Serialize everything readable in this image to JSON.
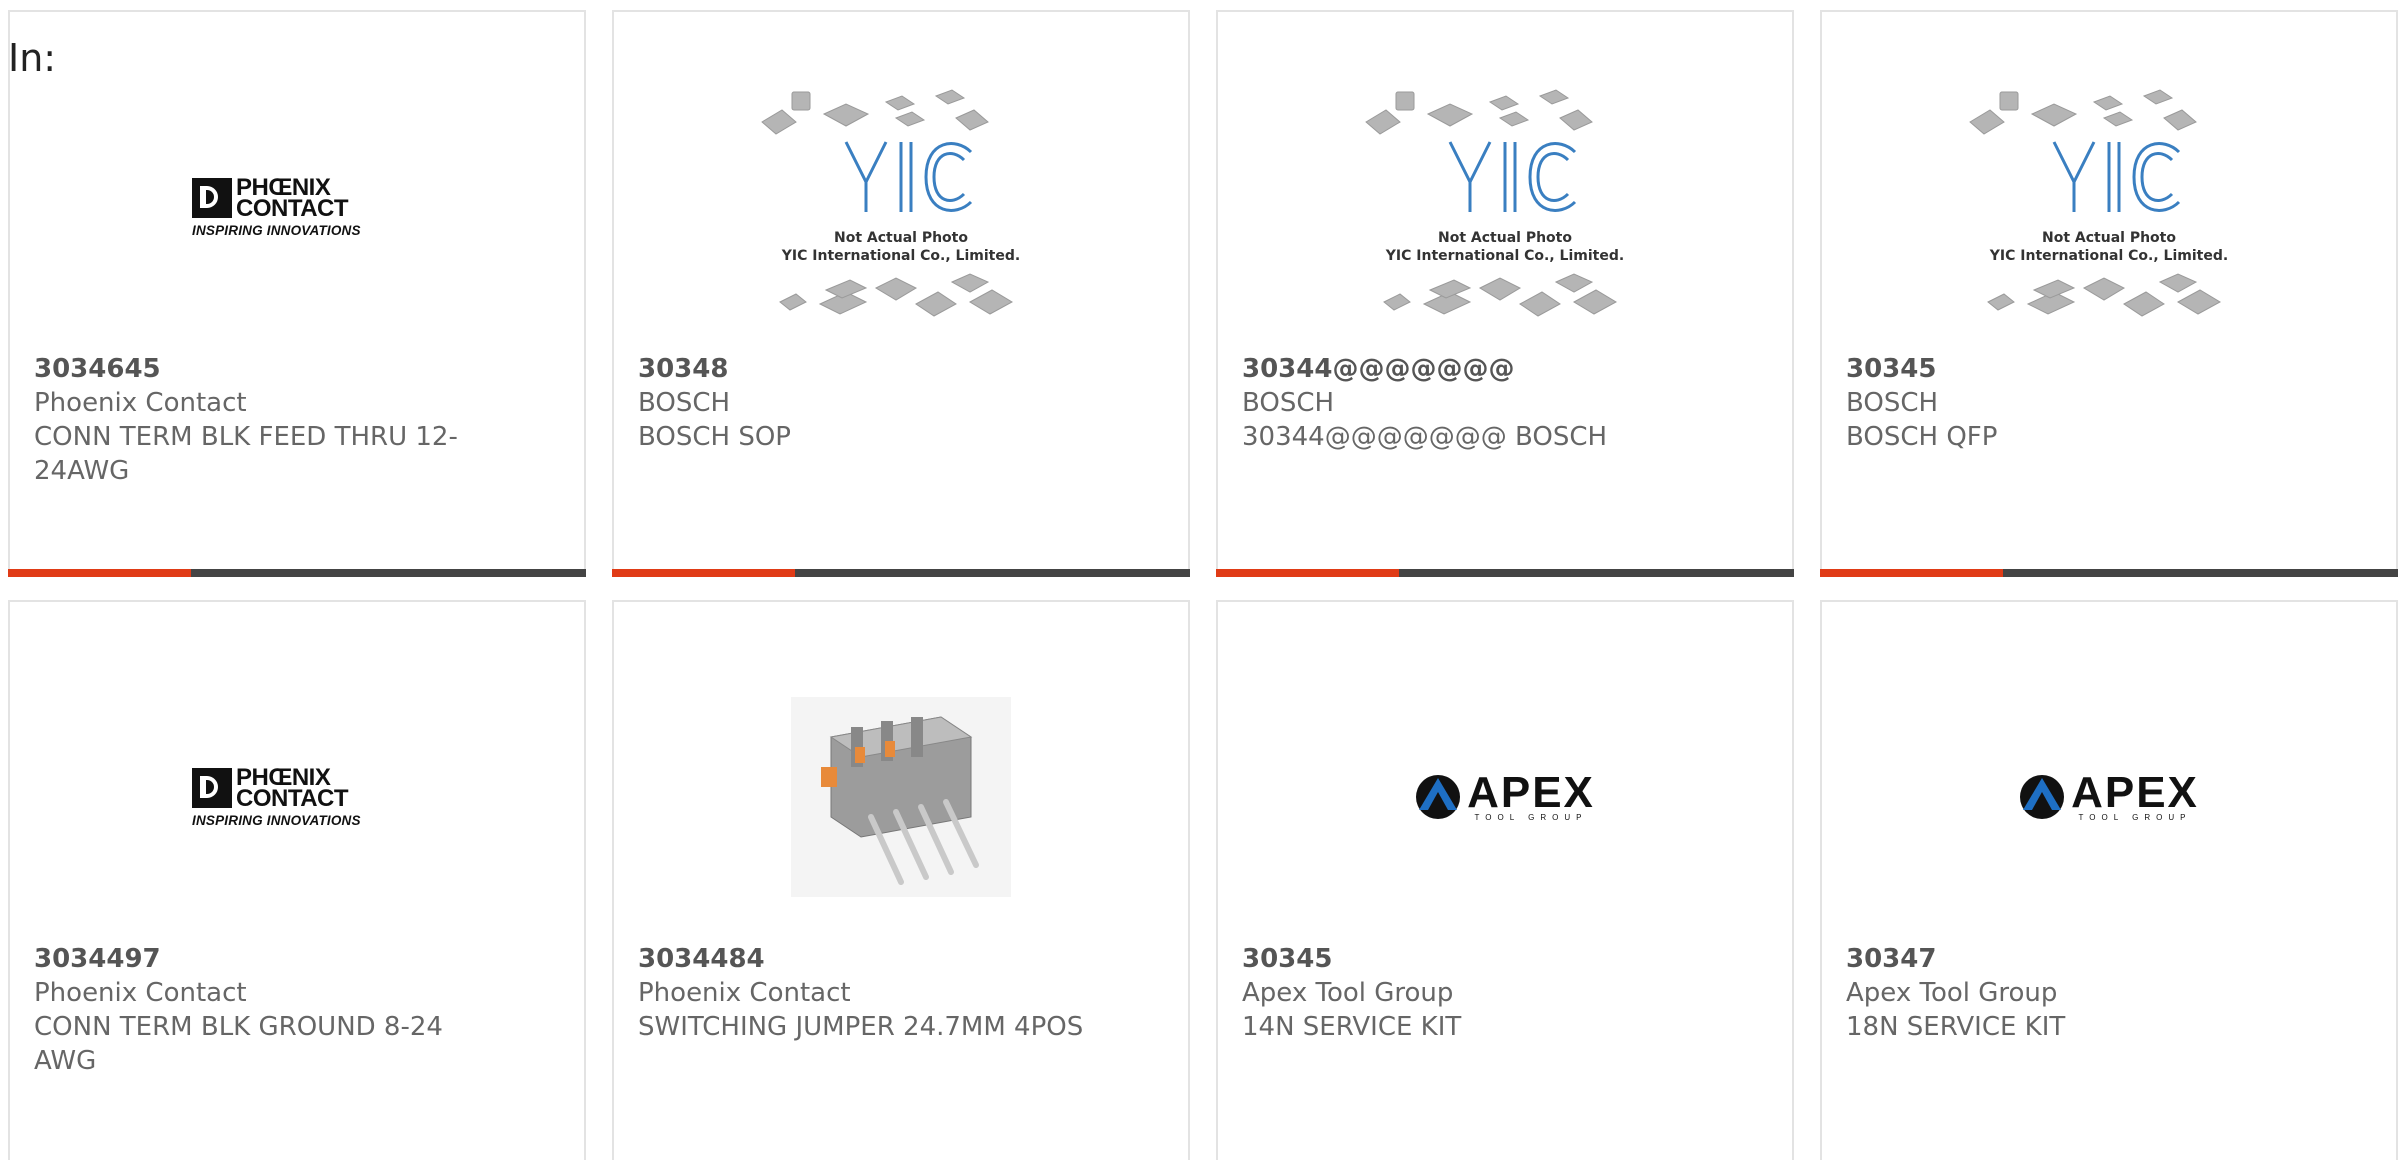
{
  "header": {
    "in_label": "In:"
  },
  "brand_colors": {
    "accent": "#e03b16",
    "bar": "#444444",
    "text": "#666666"
  },
  "logos": {
    "phoenix": {
      "line1": "PHŒNIX",
      "line2": "CONTACT",
      "tagline": "INSPIRING INNOVATIONS"
    },
    "yic": {
      "mark": "YIC",
      "line1": "Not Actual Photo",
      "line2": "YIC International Co., Limited."
    },
    "apex": {
      "name": "APEX",
      "sub": "TOOL GROUP"
    }
  },
  "products": [
    {
      "part_number": "3034645",
      "manufacturer": "Phoenix Contact",
      "description": "CONN TERM BLK FEED THRU 12-24AWG",
      "image": "phoenix-logo"
    },
    {
      "part_number": "30348",
      "manufacturer": "BOSCH",
      "description": "BOSCH SOP",
      "image": "yic-placeholder"
    },
    {
      "part_number": "30344@@@@@@@",
      "manufacturer": "BOSCH",
      "description": "30344@@@@@@@ BOSCH",
      "image": "yic-placeholder"
    },
    {
      "part_number": "30345",
      "manufacturer": "BOSCH",
      "description": "BOSCH QFP",
      "image": "yic-placeholder"
    },
    {
      "part_number": "3034497",
      "manufacturer": "Phoenix Contact",
      "description": "CONN TERM BLK GROUND 8-24 AWG",
      "image": "phoenix-logo"
    },
    {
      "part_number": "3034484",
      "manufacturer": "Phoenix Contact",
      "description": "SWITCHING JUMPER 24.7MM 4POS",
      "image": "jumper-photo"
    },
    {
      "part_number": "30345",
      "manufacturer": "Apex Tool Group",
      "description": "14N SERVICE KIT",
      "image": "apex-logo"
    },
    {
      "part_number": "30347",
      "manufacturer": "Apex Tool Group",
      "description": "18N SERVICE KIT",
      "image": "apex-logo"
    }
  ]
}
